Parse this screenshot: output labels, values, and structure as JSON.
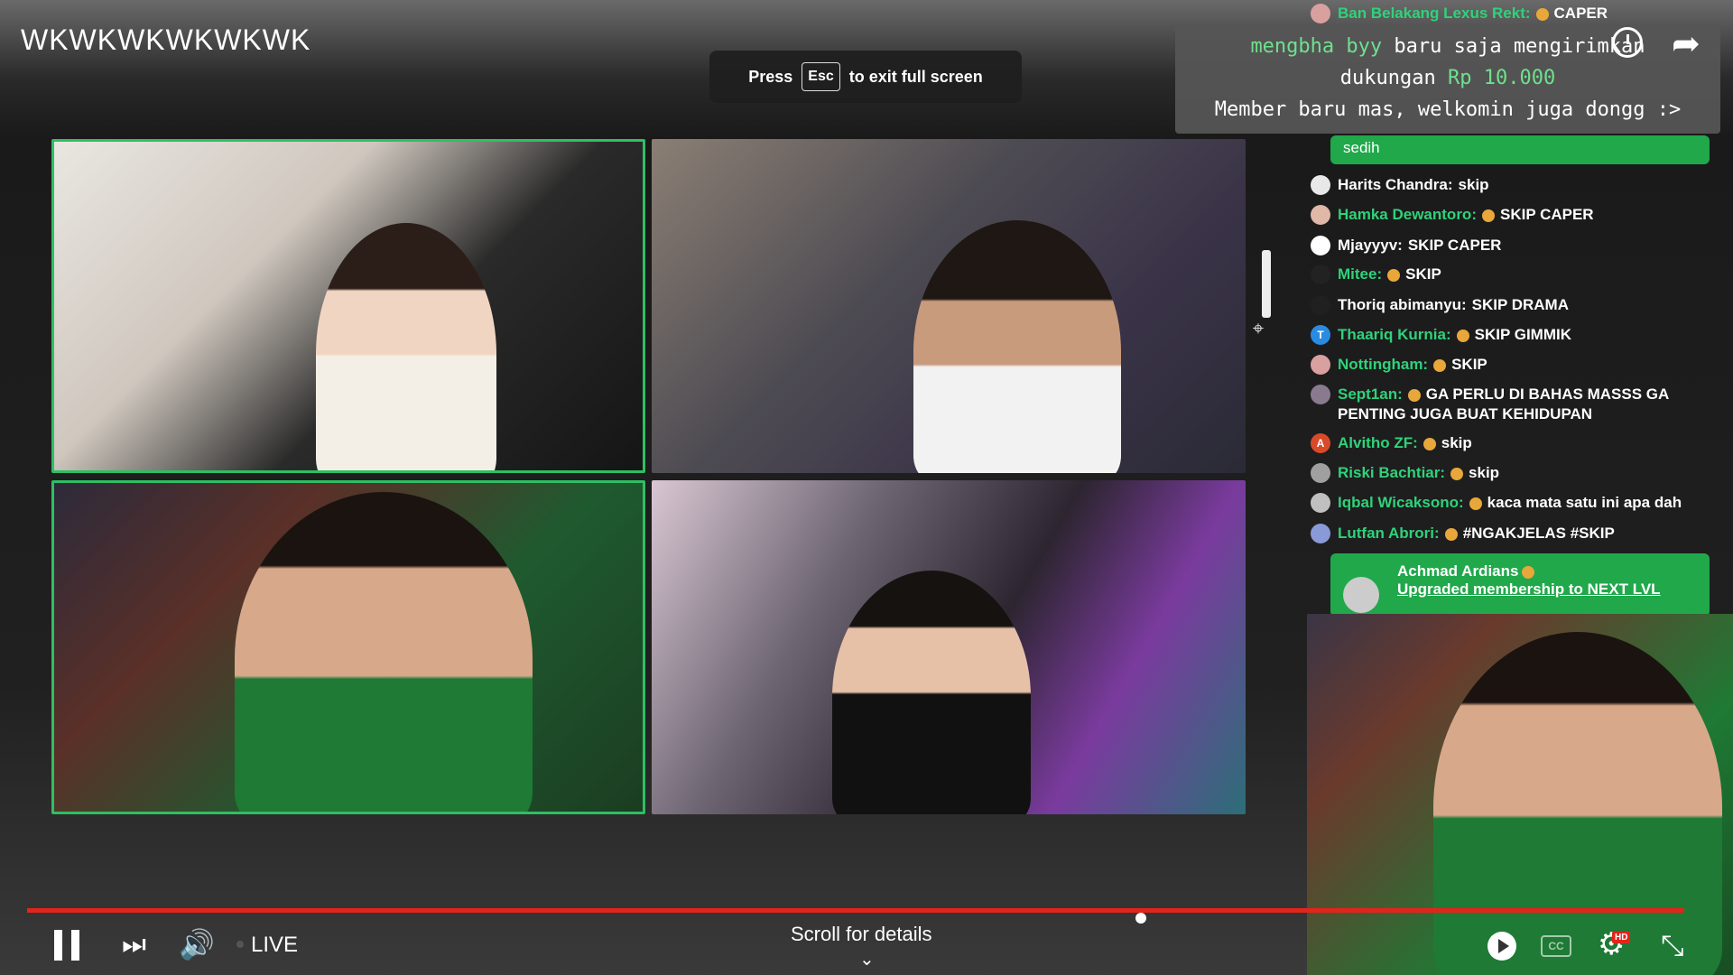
{
  "video": {
    "title": "WKWKWKWKWKWK",
    "esc_before": "Press",
    "esc_key": "Esc",
    "esc_after": "to exit full screen"
  },
  "donation": {
    "user": "mengbha byy",
    "line1_text": "baru saja mengirimkan",
    "line2_text": "dukungan",
    "amount": "Rp 10.000",
    "message": "Member baru mas, welkomin juga dongg :>"
  },
  "chat": {
    "top_partial": {
      "name": "Ban Belakang Lexus Rekt:",
      "text": "CAPER"
    },
    "pinned_text": "sedih",
    "messages": [
      {
        "name": "Harits Chandra:",
        "text": "skip",
        "name_color": "white",
        "avatar": ""
      },
      {
        "name": "Hamka Dewantoro:",
        "text": "SKIP CAPER",
        "name_color": "green",
        "avatar": ""
      },
      {
        "name": "Mjayyyv:",
        "text": "SKIP CAPER",
        "name_color": "white",
        "avatar": ""
      },
      {
        "name": "Mitee:",
        "text": "SKIP",
        "name_color": "green",
        "avatar": ""
      },
      {
        "name": "Thoriq abimanyu:",
        "text": "SKIP DRAMA",
        "name_color": "white",
        "avatar": ""
      },
      {
        "name": "Thaariq Kurnia:",
        "text": "SKIP GIMMIK",
        "name_color": "green",
        "avatar": "T"
      },
      {
        "name": "Nottingham:",
        "text": "SKIP",
        "name_color": "green",
        "avatar": ""
      },
      {
        "name": "Sept1an:",
        "text": "GA PERLU DI BAHAS MASSS GA PENTING JUGA BUAT KEHIDUPAN",
        "name_color": "green",
        "avatar": ""
      },
      {
        "name": "Alvitho ZF:",
        "text": "skip",
        "name_color": "green",
        "avatar": "A"
      },
      {
        "name": "Riski Bachtiar:",
        "text": "skip",
        "name_color": "green",
        "avatar": ""
      },
      {
        "name": "Iqbal Wicaksono:",
        "text": "kaca mata satu ini apa dah",
        "name_color": "green",
        "avatar": ""
      },
      {
        "name": "Lutfan Abrori:",
        "text": "#NGAKJELAS #SKIP",
        "name_color": "green",
        "avatar": ""
      }
    ],
    "membership": {
      "name": "Achmad Ardians",
      "text": "Upgraded membership to NEXT LVL"
    }
  },
  "controls": {
    "live_label": "LIVE",
    "scroll_hint": "Scroll for details",
    "cc_label": "CC",
    "hd_badge": "HD"
  },
  "colors": {
    "accent_green": "#2fbf63",
    "progress_red": "#e3241b"
  }
}
